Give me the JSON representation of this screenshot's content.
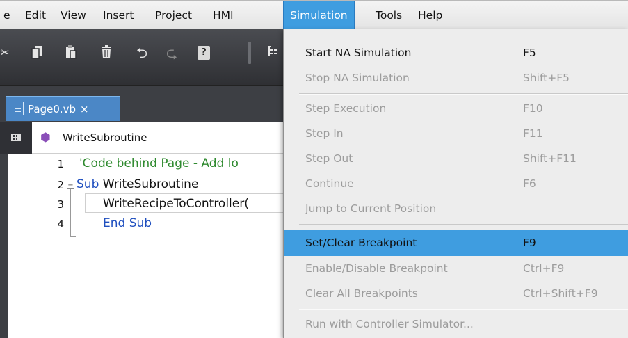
{
  "menubar": {
    "items": [
      {
        "label": "e"
      },
      {
        "label": "Edit"
      },
      {
        "label": "View"
      },
      {
        "label": "Insert"
      },
      {
        "label": "Project"
      },
      {
        "label": "HMI"
      },
      {
        "label": "Simulation"
      },
      {
        "label": "Tools"
      },
      {
        "label": "Help"
      }
    ]
  },
  "toolbar": {
    "icons": [
      "cut-icon",
      "copy-icon",
      "paste-icon",
      "delete-icon",
      "undo-icon",
      "redo-icon",
      "help-icon",
      "outline-icon"
    ],
    "help_label": "?"
  },
  "tab": {
    "label": "Page0.vb",
    "close": "×"
  },
  "navbar": {
    "procedure": "WriteSubroutine"
  },
  "editor": {
    "lines": [
      {
        "num": "1",
        "text": "'Code behind Page - Add lo"
      },
      {
        "num": "2",
        "keyword": "Sub",
        "text": " WriteSubroutine"
      },
      {
        "num": "3",
        "text": "WriteRecipeToController("
      },
      {
        "num": "4",
        "keyword": "End Sub",
        "text": ""
      }
    ]
  },
  "simulation_menu": {
    "items": [
      {
        "label": "Start NA Simulation",
        "shortcut": "F5"
      },
      {
        "label": "Stop NA Simulation",
        "shortcut": "Shift+F5"
      },
      {
        "label": "Step Execution",
        "shortcut": "F10"
      },
      {
        "label": "Step In",
        "shortcut": "F11"
      },
      {
        "label": "Step Out",
        "shortcut": "Shift+F11"
      },
      {
        "label": "Continue",
        "shortcut": "F6"
      },
      {
        "label": "Jump to Current Position",
        "shortcut": ""
      },
      {
        "label": "Set/Clear Breakpoint",
        "shortcut": "F9"
      },
      {
        "label": "Enable/Disable Breakpoint",
        "shortcut": "Ctrl+F9"
      },
      {
        "label": "Clear All Breakpoints",
        "shortcut": "Ctrl+Shift+F9"
      },
      {
        "label": "Run with Controller Simulator...",
        "shortcut": ""
      }
    ]
  },
  "colors": {
    "accent": "#3f9de0",
    "tab": "#4b87c6",
    "disabled": "#9c9c9c",
    "comment": "#2f8a2f",
    "keyword": "#1f4fbf"
  }
}
